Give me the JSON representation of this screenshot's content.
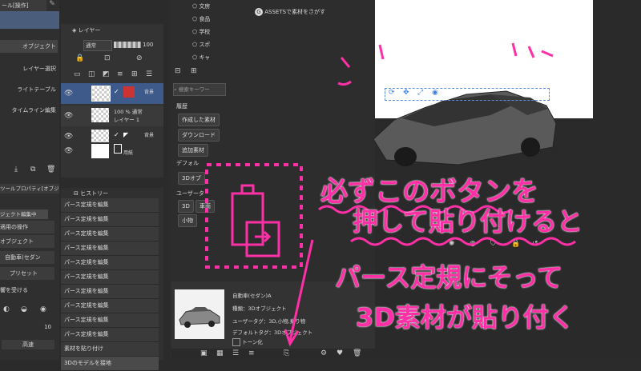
{
  "left_tabs": {
    "tab_label": "ール[操作]"
  },
  "left_menu": [
    {
      "label": "オブジェクト"
    },
    {
      "label": "レイヤー選択"
    },
    {
      "label": "ライトテーブル"
    },
    {
      "label": "タイムライン編集"
    }
  ],
  "layer_panel": {
    "title": "レイヤー",
    "blend_mode": "通常",
    "opacity": "100",
    "layers": [
      {
        "name_line1": "",
        "name_line2": "",
        "badge": "背景",
        "selected": true
      },
      {
        "name_line1": "100 % 通常",
        "name_line2": "レイヤー 1",
        "badge": "",
        "selected": false
      },
      {
        "name_line1": "",
        "name_line2": "",
        "badge": "背景",
        "selected": false
      },
      {
        "name_line1": "",
        "name_line2": "用紙",
        "badge": "",
        "selected": false
      }
    ]
  },
  "tool_property": {
    "title": "ツールプロパティ[オブジェクト]",
    "tab_label": "ジェクト編集中",
    "items": [
      {
        "label": "適用の操作"
      },
      {
        "label": "オブジェクト"
      },
      {
        "label": "自動車(セダン"
      },
      {
        "label": "プリセット"
      },
      {
        "label": "響を受ける"
      }
    ],
    "number": "10",
    "quality": "高速"
  },
  "history_panel": {
    "title": "ヒストリー",
    "items": [
      "パース定規を編集",
      "パース定規を編集",
      "パース定規を編集",
      "パース定規を編集",
      "パース定規を編集",
      "パース定規を編集",
      "パース定規を編集",
      "パース定規を編集",
      "パース定規を編集",
      "パース定規を編集",
      "素材を貼り付け",
      "3Dのモデルを接地"
    ]
  },
  "material_panel": {
    "categories": [
      "文房",
      "食品",
      "学校",
      "スポ",
      "キャ"
    ],
    "assets_label": "ASSETSで素材をさがす",
    "search_placeholder": "検索キーワー",
    "history_label": "履歴",
    "buttons": [
      "作成した素材",
      "ダウンロード",
      "追加素材"
    ],
    "default_tag": "デフォル",
    "tag_3d": "3Dオブ",
    "user_tag": "ユーザータ",
    "chips": [
      "3D",
      "車両",
      "小物"
    ],
    "detail": {
      "name": "自動車(セダン)A",
      "kind": "種類：3Dオブジェクト",
      "user_tag": "ユーザータグ：3D,小物,乗り物",
      "default_tag": "デフォルトタグ：3Dオブジェクト",
      "toon": "トーン化"
    }
  },
  "annotations": {
    "line1": "必ずこのボタンを",
    "line2": "押して貼り付けると",
    "line3": "パース定規にそって",
    "line4": "3D素材が貼り付く"
  },
  "colors": {
    "annotation": "#ff2fa6",
    "selected_layer": "#3d5a8a",
    "panel": "#333333",
    "canvas": "#ffffff"
  }
}
